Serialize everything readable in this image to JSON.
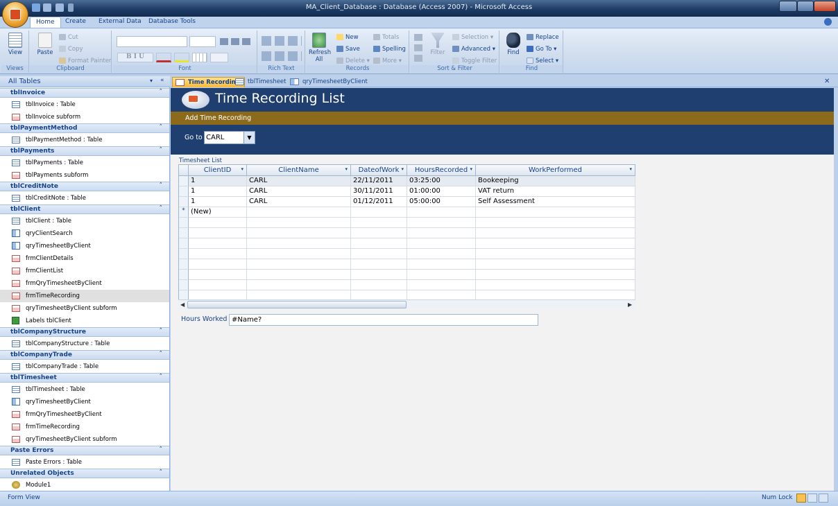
{
  "window": {
    "title": "MA_Client_Database : Database (Access 2007) - Microsoft Access"
  },
  "ribbon_tabs": [
    "Home",
    "Create",
    "External Data",
    "Database Tools"
  ],
  "ribbon": {
    "views": {
      "view": "View",
      "label": "Views"
    },
    "clipboard": {
      "paste": "Paste",
      "cut": "Cut",
      "copy": "Copy",
      "format_painter": "Format Painter",
      "label": "Clipboard"
    },
    "font": {
      "label": "Font"
    },
    "rich_text": {
      "label": "Rich Text"
    },
    "records": {
      "refresh": "Refresh All",
      "new": "New",
      "save": "Save",
      "delete": "Delete",
      "totals": "Totals",
      "spelling": "Spelling",
      "more": "More",
      "label": "Records"
    },
    "sort_filter": {
      "filter": "Filter",
      "selection": "Selection",
      "advanced": "Advanced",
      "toggle_filter": "Toggle Filter",
      "label": "Sort & Filter"
    },
    "find": {
      "find": "Find",
      "replace": "Replace",
      "goto": "Go To",
      "select": "Select",
      "label": "Find"
    }
  },
  "nav": {
    "header": "All Tables",
    "groups": [
      {
        "name": "tblInvoice",
        "items": [
          {
            "label": "tblInvoice : Table",
            "icon": "table"
          },
          {
            "label": "tblInvoice subform",
            "icon": "form"
          }
        ]
      },
      {
        "name": "tblPaymentMethod",
        "items": [
          {
            "label": "tblPaymentMethod : Table",
            "icon": "table"
          }
        ]
      },
      {
        "name": "tblPayments",
        "items": [
          {
            "label": "tblPayments : Table",
            "icon": "table"
          },
          {
            "label": "tblPayments subform",
            "icon": "form"
          }
        ]
      },
      {
        "name": "tblCreditNote",
        "items": [
          {
            "label": "tblCreditNote : Table",
            "icon": "table"
          }
        ]
      },
      {
        "name": "tblClient",
        "items": [
          {
            "label": "tblClient : Table",
            "icon": "table"
          },
          {
            "label": "qryClientSearch",
            "icon": "query"
          },
          {
            "label": "qryTimesheetByClient",
            "icon": "query"
          },
          {
            "label": "frmClientDetails",
            "icon": "form"
          },
          {
            "label": "frmClientList",
            "icon": "form"
          },
          {
            "label": "frmQryTimesheetByClient",
            "icon": "form"
          },
          {
            "label": "frmTimeRecording",
            "icon": "form",
            "selected": true
          },
          {
            "label": "qryTimesheetByClient subform",
            "icon": "form"
          },
          {
            "label": "Labels tblClient",
            "icon": "report"
          }
        ]
      },
      {
        "name": "tblCompanyStructure",
        "items": [
          {
            "label": "tblCompanyStructure : Table",
            "icon": "table"
          }
        ]
      },
      {
        "name": "tblCompanyTrade",
        "items": [
          {
            "label": "tblCompanyTrade : Table",
            "icon": "table"
          }
        ]
      },
      {
        "name": "tblTimesheet",
        "items": [
          {
            "label": "tblTimesheet : Table",
            "icon": "table"
          },
          {
            "label": "qryTimesheetByClient",
            "icon": "query"
          },
          {
            "label": "frmQryTimesheetByClient",
            "icon": "form"
          },
          {
            "label": "frmTimeRecording",
            "icon": "form"
          },
          {
            "label": "qryTimesheetByClient subform",
            "icon": "form"
          }
        ]
      },
      {
        "name": "Paste Errors",
        "items": [
          {
            "label": "Paste Errors : Table",
            "icon": "table"
          }
        ]
      },
      {
        "name": "Unrelated Objects",
        "items": [
          {
            "label": "Module1",
            "icon": "module"
          }
        ]
      }
    ]
  },
  "doc_tabs": [
    "Time Recording",
    "tblTimesheet",
    "qryTimesheetByClient"
  ],
  "form": {
    "title": "Time Recording List",
    "add_button": "Add Time Recording",
    "goto_label": "Go to",
    "goto_value": "CARL",
    "subform_label": "Timesheet List",
    "hours_label": "Hours Worked",
    "hours_value": "#Name?"
  },
  "grid": {
    "columns": [
      "ClientID",
      "ClientName",
      "DateofWork",
      "HoursRecorded",
      "WorkPerformed"
    ],
    "rows": [
      [
        "1",
        "CARL",
        "22/11/2011",
        "03:25:00",
        "Bookeeping"
      ],
      [
        "1",
        "CARL",
        "30/11/2011",
        "01:00:00",
        "VAT return"
      ],
      [
        "1",
        "CARL",
        "01/12/2011",
        "05:00:00",
        "Self Assessment"
      ]
    ],
    "new_row": "(New)"
  },
  "status": {
    "left": "Form View",
    "numlock": "Num Lock"
  }
}
